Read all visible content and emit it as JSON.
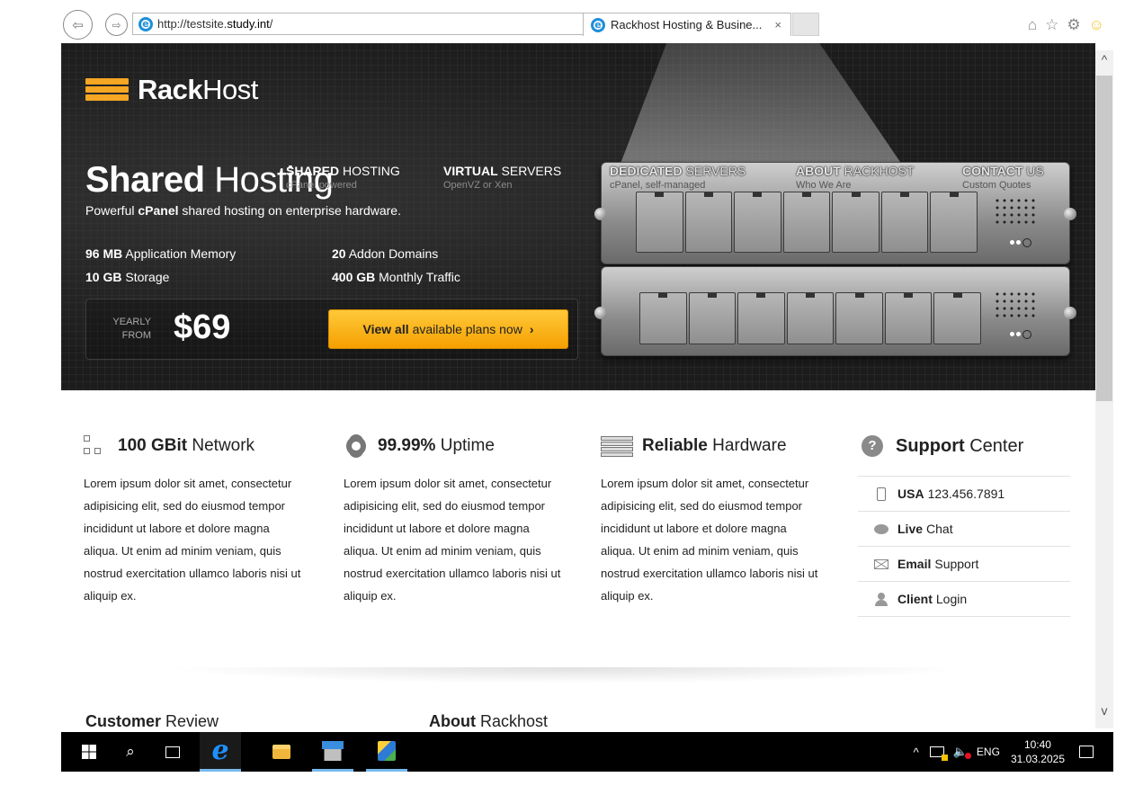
{
  "browser": {
    "url_prefix": "http://testsite.",
    "url_domain": "study.int",
    "url_suffix": "/",
    "address_tools": "⌕ ▾ ↻",
    "tab_title": "Rackhost Hosting & Busine...",
    "tab_close": "×",
    "back": "⇦",
    "forward": "⇨",
    "icons": [
      "home-icon",
      "star-icon",
      "gear-icon",
      "smiley-icon"
    ]
  },
  "logo": {
    "bold": "Rack",
    "light": "Host"
  },
  "nav": {
    "items": [
      {
        "bold": "SHARED",
        "light": " HOSTING",
        "sub": "cPanel powered"
      },
      {
        "bold": "VIRTUAL",
        "light": " SERVERS",
        "sub": "OpenVZ or Xen"
      },
      {
        "bold": "DEDICATED",
        "light": " SERVERS",
        "sub": "cPanel, self-managed"
      },
      {
        "bold": "ABOUT",
        "light": " RACKHOST",
        "sub": "Who We Are"
      },
      {
        "bold": "CONTACT",
        "light": " US",
        "sub": "Custom Quotes"
      }
    ]
  },
  "hero": {
    "title_bold": "Shared",
    "title_light": " Hosting",
    "subtitle_pre": "Powerful ",
    "subtitle_bold": "cPanel",
    "subtitle_post": " shared hosting on enterprise hardware.",
    "features": [
      {
        "bold": "96 MB",
        "text": " Application Memory"
      },
      {
        "bold": "10 GB",
        "text": " Storage"
      },
      {
        "bold": "20",
        "text": " Addon Domains"
      },
      {
        "bold": "400 GB",
        "text": " Monthly Traffic"
      }
    ],
    "price_label_1": "YEARLY",
    "price_label_2": "FROM",
    "price": "$69",
    "cta_bold": "View all",
    "cta_text": "available plans now",
    "cta_chevron": "›"
  },
  "columns": [
    {
      "bold": "100 GBit",
      "light": " Network",
      "text": "Lorem ipsum dolor sit amet, consectetur adipisicing elit, sed do eiusmod tempor incididunt ut labore et dolore magna aliqua. Ut enim ad minim veniam, quis nostrud exercitation ullamco laboris nisi ut aliquip ex."
    },
    {
      "bold": "99.99%",
      "light": " Uptime",
      "text": "Lorem ipsum dolor sit amet, consectetur adipisicing elit, sed do eiusmod tempor incididunt ut labore et dolore magna aliqua. Ut enim ad minim veniam, quis nostrud exercitation ullamco laboris nisi ut aliquip ex."
    },
    {
      "bold": "Reliable",
      "light": " Hardware",
      "text": "Lorem ipsum dolor sit amet, consectetur adipisicing elit, sed do eiusmod tempor incididunt ut labore et dolore magna aliqua. Ut enim ad minim veniam, quis nostrud exercitation ullamco laboris nisi ut aliquip ex."
    }
  ],
  "support": {
    "help_glyph": "?",
    "title_bold": "Support",
    "title_light": " Center",
    "items": [
      {
        "bold": "USA",
        "text": "123.456.7891"
      },
      {
        "bold": "Live",
        "text": "Chat"
      },
      {
        "bold": "Email",
        "text": "Support"
      },
      {
        "bold": "Client",
        "text": "Login"
      }
    ]
  },
  "bottom": {
    "review_bold": "Customer",
    "review_light": " Review",
    "about_bold": "About",
    "about_light": " Rackhost"
  },
  "taskbar": {
    "search_glyph": "⌕",
    "ie_glyph": "e",
    "tray_up": "^",
    "volume_glyph": "🔈",
    "lang": "ENG",
    "time": "10:40",
    "date": "31.03.2025"
  },
  "scrollbar": {
    "up": "^",
    "down": "v"
  }
}
